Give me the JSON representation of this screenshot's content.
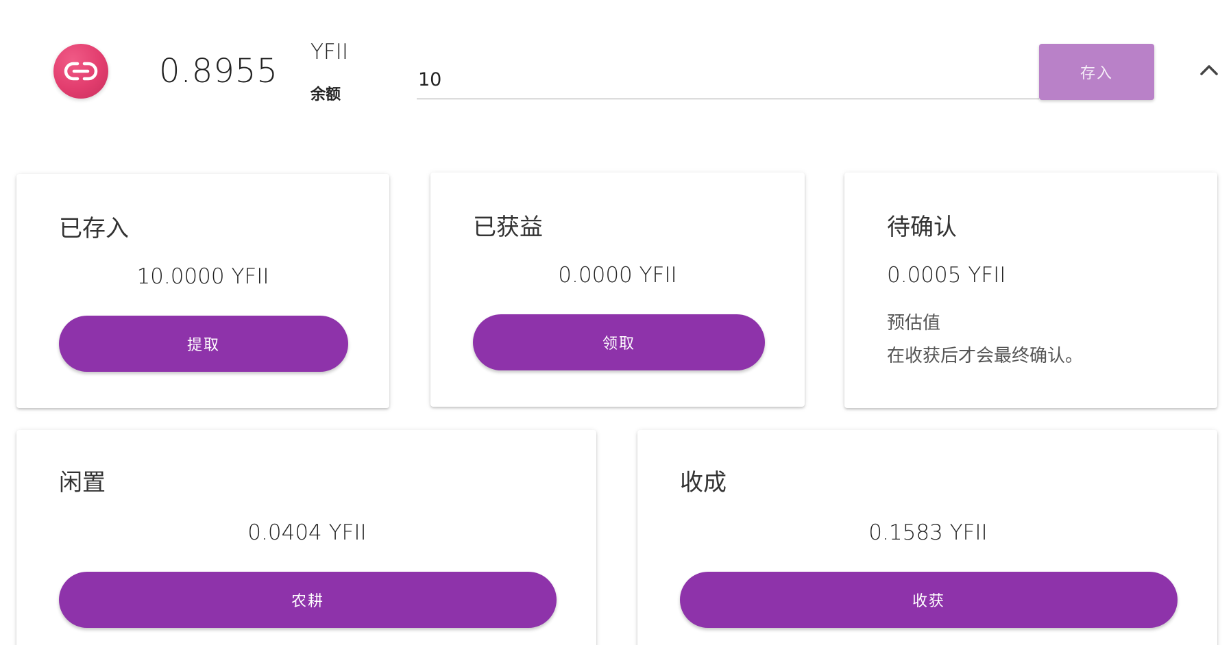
{
  "header": {
    "token_icon": "link-chain-icon",
    "balance_value": "0.8955",
    "balance_symbol": "YFII",
    "balance_caption": "余额",
    "amount_input_value": "10",
    "deposit_label": "存入",
    "collapse_icon": "chevron-up-icon"
  },
  "cards": {
    "staked": {
      "title": "已存入",
      "amount": "10.0000 YFII",
      "button_label": "提取"
    },
    "earned": {
      "title": "已获益",
      "amount": "0.0000 YFII",
      "button_label": "领取"
    },
    "pending": {
      "title": "待确认",
      "amount": "0.0005 YFII",
      "note_line1": "预估值",
      "note_line2": "在收获后才会最终确认。"
    },
    "idle": {
      "title": "闲置",
      "amount": "0.0404 YFII",
      "button_label": "农耕"
    },
    "harvest": {
      "title": "收成",
      "amount": "0.1583 YFII",
      "button_label": "收获"
    }
  },
  "colors": {
    "primary_purple": "#8e33aa",
    "deposit_button": "#b981c8",
    "logo_pink": "#e23d6e"
  }
}
